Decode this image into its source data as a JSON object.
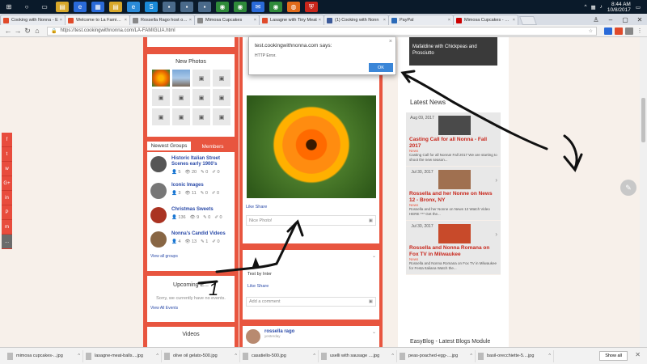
{
  "taskbar": {
    "icons": [
      "windows-icon",
      "search-icon",
      "task-view-icon",
      "file-explorer-icon",
      "edge-icon",
      "store-icon",
      "folder-icon",
      "ie-icon",
      "skype-icon",
      "app-icon",
      "app-icon",
      "app-icon",
      "chrome-icon",
      "chrome-icon",
      "mail-icon",
      "chrome-icon",
      "firefox-icon",
      "shield-icon"
    ],
    "time": "8:44 AM",
    "date": "10/8/2017"
  },
  "tabs": [
    {
      "label": "Cooking with Nonna - E",
      "active": false,
      "color": "#e04a2a"
    },
    {
      "label": "Welcome to La Famiglia",
      "active": true,
      "color": "#e04a2a"
    },
    {
      "label": "Rossella Rago host of C",
      "active": false,
      "color": "#888888"
    },
    {
      "label": "Mimosa Cupcakes",
      "active": false,
      "color": "#888888"
    },
    {
      "label": "Lasagne with Tiny Meat",
      "active": false,
      "color": "#e04a2a"
    },
    {
      "label": "(1) Cooking with Nonn",
      "active": false,
      "color": "#3b5998"
    },
    {
      "label": "PayPal",
      "active": false,
      "color": "#2a6ab8"
    },
    {
      "label": "Mimosa Cupcakes - Rec",
      "active": false,
      "color": "#cc0000"
    }
  ],
  "address": {
    "url": "https://test.cookingwithnonna.com/LA-FAMIGLIA.html"
  },
  "social": [
    "f",
    "t",
    "w",
    "G+",
    "in",
    "P",
    "m",
    "..."
  ],
  "left": {
    "new_photos_title": "New Photos",
    "group_tab_active": "Newest Groups",
    "group_tab_other": "Members",
    "groups": [
      {
        "title": "Historic Italian Street Scenes early 1900's",
        "members": "5",
        "views": "20",
        "posts": "0",
        "edits": "0",
        "color": "#555555"
      },
      {
        "title": "Iconic Images",
        "members": "3",
        "views": "11",
        "posts": "0",
        "edits": "0",
        "color": "#777777"
      },
      {
        "title": "Christmas Sweets",
        "members": "136",
        "views": "9",
        "posts": "0",
        "edits": "0",
        "color": "#aa3322"
      },
      {
        "title": "Nonna's Candid Videos",
        "members": "4",
        "views": "13",
        "posts": "1",
        "edits": "0",
        "color": "#886644"
      }
    ],
    "view_all_groups": "View all groups",
    "upcoming_title": "Upcoming E...",
    "no_events": "Sorry, we currently have no events.",
    "view_all_events": "View All Events",
    "videos_title": "Videos"
  },
  "mid": {
    "like_share": "Like  Share",
    "nice_photo": "Nice Photo!",
    "posted_text": "Test by Inter",
    "like_share_2": "Like  Share",
    "add_comment": "Add a comment",
    "author": "rossella rago",
    "author_time": "yesterday"
  },
  "right": {
    "top_title": "Mafaldine with Chickpeas and Prosciutto",
    "latest_news": "Latest News",
    "news": [
      {
        "date": "Aug 09, 2017",
        "title": "Casting Call for all Nonna - Fall 2017",
        "cat": "News",
        "snip": "Casting Call for all Nonna! Fall 2017 We are starting to shoot the new season...",
        "thumb": "#4a4a4a"
      },
      {
        "date": "Jul 30, 2017",
        "title": "Rossella and her Nonne on News 12 - Bronx, NY",
        "cat": "News",
        "snip": "Rossella and her Nonne on News 12 Watch Video HERE *** Get the...",
        "thumb": "#a07050"
      },
      {
        "date": "Jul 30, 2017",
        "title": "Rossella and Nonna Romana on Fox TV in Milwaukee",
        "cat": "News",
        "snip": "Rossella and Nonna Romana on Fox TV in Milwaukee for Festa Italiana Watch the...",
        "thumb": "#c84a2a"
      }
    ],
    "easyblog": "EasyBlog - Latest Blogs Module"
  },
  "dialog": {
    "title": "test.cookingwithnonna.com says:",
    "message": "HTTP Error.",
    "ok": "OK",
    "close": "×"
  },
  "annotation_label": "1",
  "downloads": {
    "items": [
      "mimosa cupcakes-...jpg",
      "lasagne-meat-balls....jpg",
      "olive oil gelato-500.jpg",
      "casatiello-500.jpg",
      "uselli with sausage ....jpg",
      "peas-poached-egg-....jpg",
      "basil-orecchiette-5....jpg"
    ],
    "show_all": "Show all"
  }
}
